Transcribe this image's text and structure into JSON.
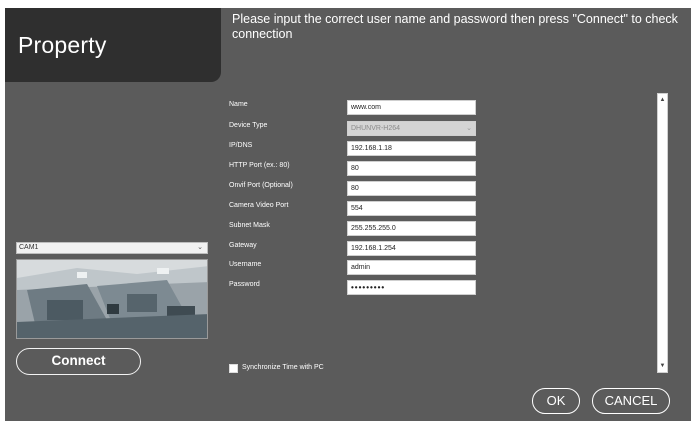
{
  "dialog": {
    "title": "Property",
    "instruction": "Please input the correct user name and password then press \"Connect\" to check connection"
  },
  "camera": {
    "selected": "CAM1",
    "connect_label": "Connect"
  },
  "form": {
    "fields": [
      {
        "label": "Name",
        "value": "www.com"
      },
      {
        "label": "Device Type",
        "value": "DHUNVR-H264"
      },
      {
        "label": "IP/DNS",
        "value": "192.168.1.18"
      },
      {
        "label": "HTTP Port (ex.: 80)",
        "value": "80"
      },
      {
        "label": "Onvif Port (Optional)",
        "value": "80"
      },
      {
        "label": "Camera Video Port",
        "value": "554"
      },
      {
        "label": "Subnet Mask",
        "value": "255.255.255.0"
      },
      {
        "label": "Gateway",
        "value": "192.168.1.254"
      },
      {
        "label": "Username",
        "value": "admin"
      },
      {
        "label": "Password",
        "value": "•••••••••"
      }
    ],
    "sync_label": "Synchronize Time with PC"
  },
  "actions": {
    "ok_label": "OK",
    "cancel_label": "CANCEL"
  },
  "icons": {
    "chevron_down": "⌄",
    "scroll_up": "▲",
    "scroll_down": "▼"
  }
}
